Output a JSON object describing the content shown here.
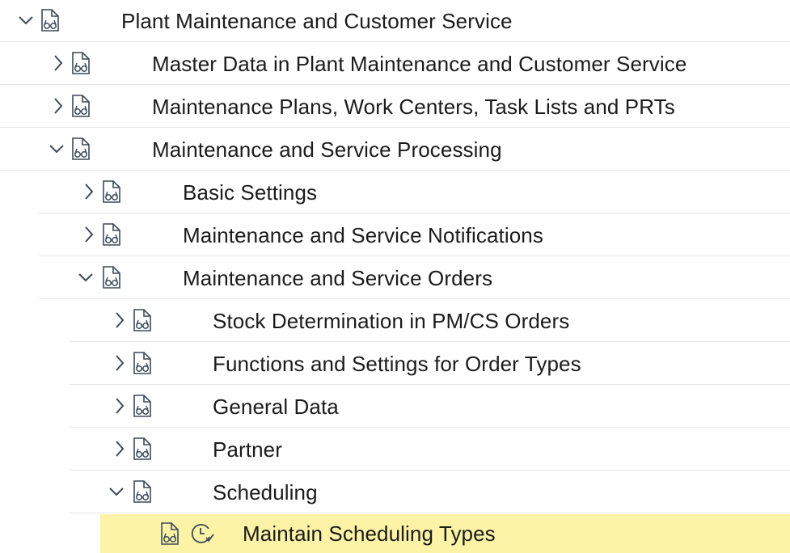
{
  "tree": {
    "rows": [
      {
        "label": "Plant Maintenance and Customer Service",
        "level": 0,
        "expanded": true,
        "selected": false,
        "chevron": "chevron-down-icon",
        "icons": [
          "document-glasses-icon"
        ]
      },
      {
        "label": "Master Data in Plant Maintenance and Customer Service",
        "level": 1,
        "expanded": false,
        "selected": false,
        "chevron": "chevron-right-icon",
        "icons": [
          "document-glasses-icon"
        ]
      },
      {
        "label": "Maintenance Plans, Work Centers, Task Lists and PRTs",
        "level": 1,
        "expanded": false,
        "selected": false,
        "chevron": "chevron-right-icon",
        "icons": [
          "document-glasses-icon"
        ]
      },
      {
        "label": "Maintenance and Service Processing",
        "level": 1,
        "expanded": true,
        "selected": false,
        "chevron": "chevron-down-icon",
        "icons": [
          "document-glasses-icon"
        ]
      },
      {
        "label": "Basic Settings",
        "level": 2,
        "expanded": false,
        "selected": false,
        "chevron": "chevron-right-icon",
        "icons": [
          "document-glasses-icon"
        ]
      },
      {
        "label": "Maintenance and Service Notifications",
        "level": 2,
        "expanded": false,
        "selected": false,
        "chevron": "chevron-right-icon",
        "icons": [
          "document-glasses-icon"
        ]
      },
      {
        "label": "Maintenance and Service Orders",
        "level": 2,
        "expanded": true,
        "selected": false,
        "chevron": "chevron-down-icon",
        "icons": [
          "document-glasses-icon"
        ]
      },
      {
        "label": "Stock Determination in PM/CS Orders",
        "level": 3,
        "expanded": false,
        "selected": false,
        "chevron": "chevron-right-icon",
        "icons": [
          "document-glasses-icon"
        ]
      },
      {
        "label": "Functions and Settings for Order Types",
        "level": 3,
        "expanded": false,
        "selected": false,
        "chevron": "chevron-right-icon",
        "icons": [
          "document-glasses-icon"
        ]
      },
      {
        "label": "General Data",
        "level": 3,
        "expanded": false,
        "selected": false,
        "chevron": "chevron-right-icon",
        "icons": [
          "document-glasses-icon"
        ]
      },
      {
        "label": "Partner",
        "level": 3,
        "expanded": false,
        "selected": false,
        "chevron": "chevron-right-icon",
        "icons": [
          "document-glasses-icon"
        ]
      },
      {
        "label": "Scheduling",
        "level": 3,
        "expanded": true,
        "selected": false,
        "chevron": "chevron-down-icon",
        "icons": [
          "document-glasses-icon"
        ]
      },
      {
        "label": "Maintain Scheduling Types",
        "level": 4,
        "expanded": false,
        "selected": true,
        "chevron": "",
        "icons": [
          "document-glasses-icon",
          "clock-execute-icon"
        ]
      }
    ]
  },
  "colors": {
    "text": "#1b1b1b",
    "icon": "#3b4a5a",
    "selected_row_bg": "#fdf3a6",
    "divider": "#e6e6e6"
  }
}
